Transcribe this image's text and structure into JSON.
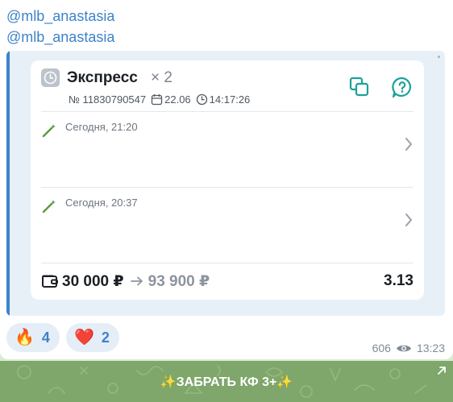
{
  "message": {
    "mentions": [
      "@mlb_anastasia",
      "@mlb_anastasia"
    ],
    "bet": {
      "title": "Экспресс",
      "count": "× 2",
      "number": "№ 11830790547",
      "date": "22.06",
      "time": "14:17:26",
      "events": [
        {
          "time": "Сегодня, 21:20"
        },
        {
          "time": "Сегодня, 20:37"
        }
      ],
      "stake": "30 000 ₽",
      "payout": "93 900 ₽",
      "odds": "3.13"
    },
    "reactions": [
      {
        "emoji": "🔥",
        "count": "4"
      },
      {
        "emoji": "❤️",
        "count": "2"
      }
    ],
    "views": "606",
    "sent_time": "13:23"
  },
  "button": {
    "label": "✨ЗАБРАТЬ КФ 3+✨"
  },
  "colors": {
    "accent": "#3d83c8",
    "teal": "#1ba19a",
    "button": "#7fa66b"
  }
}
